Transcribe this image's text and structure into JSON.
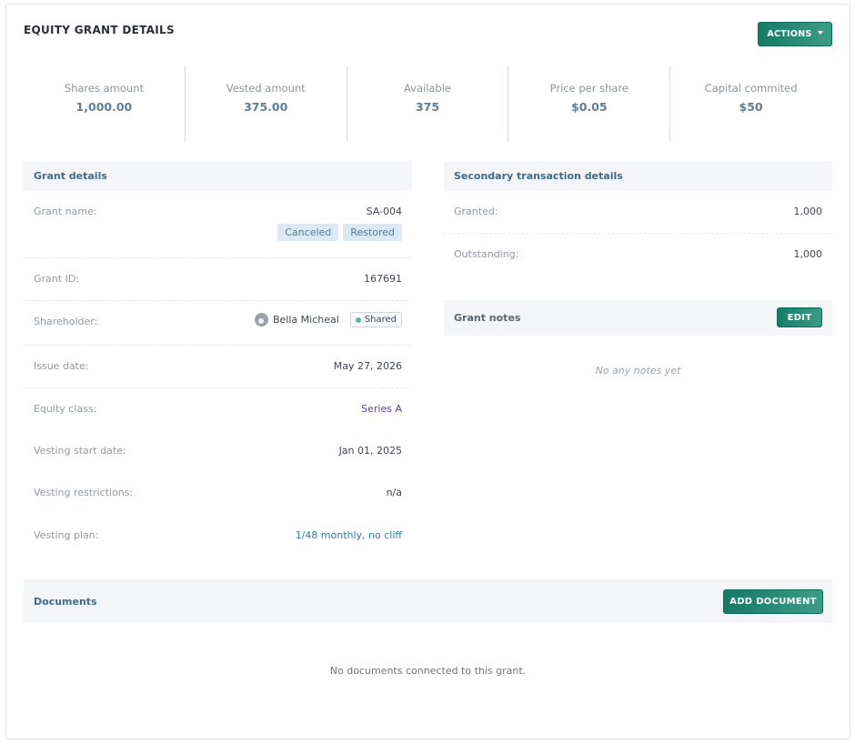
{
  "header": {
    "title": "EQUITY GRANT DETAILS",
    "actions_label": "ACTIONS"
  },
  "stats": [
    {
      "label": "Shares amount",
      "value": "1,000.00"
    },
    {
      "label": "Vested amount",
      "value": "375.00"
    },
    {
      "label": "Available",
      "value": "375"
    },
    {
      "label": "Price per share",
      "value": "$0.05"
    },
    {
      "label": "Capital commited",
      "value": "$50"
    }
  ],
  "grant_details": {
    "title": "Grant details",
    "grant_name": {
      "label": "Grant name:",
      "value": "SA-004",
      "badges": [
        "Canceled",
        "Restored"
      ]
    },
    "grant_id": {
      "label": "Grant ID:",
      "value": "167691"
    },
    "shareholder": {
      "label": "Shareholder:",
      "name": "Bella Micheal",
      "chip": "Shared"
    },
    "issue_date": {
      "label": "Issue date:",
      "value": "May 27, 2026"
    },
    "equity_class": {
      "label": "Equity class:",
      "value": "Series A"
    },
    "vesting_start": {
      "label": "Vesting start date:",
      "value": "Jan 01, 2025"
    },
    "vesting_restrictions": {
      "label": "Vesting restrictions:",
      "value": "n/a"
    },
    "vesting_plan": {
      "label": "Vesting plan:",
      "value": "1/48 monthly, no cliff"
    }
  },
  "secondary": {
    "title": "Secondary transaction details",
    "granted": {
      "label": "Granted:",
      "value": "1,000"
    },
    "outstanding": {
      "label": "Outstanding:",
      "value": "1,000"
    }
  },
  "notes": {
    "title": "Grant notes",
    "edit_label": "EDIT",
    "empty": "No any notes yet"
  },
  "documents": {
    "title": "Documents",
    "add_label": "ADD DOCUMENT",
    "empty": "No documents connected to this grant."
  }
}
